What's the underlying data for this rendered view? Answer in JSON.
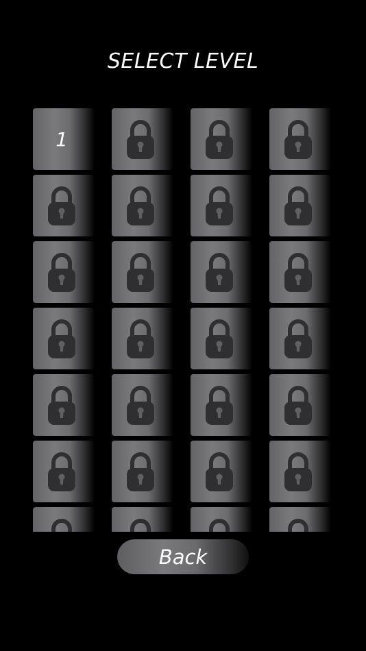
{
  "screen": {
    "title": "SELECT LEVEL"
  },
  "levels": {
    "columns": 4,
    "visible_rows": 7,
    "unlocked": [
      "1"
    ],
    "locked_icon": "padlock-icon"
  },
  "back_button": {
    "label": "Back"
  },
  "colors": {
    "background": "#000000",
    "tile_gray": "#7a7a7d",
    "lock_dark": "#2f2f31",
    "text": "#ffffff"
  }
}
